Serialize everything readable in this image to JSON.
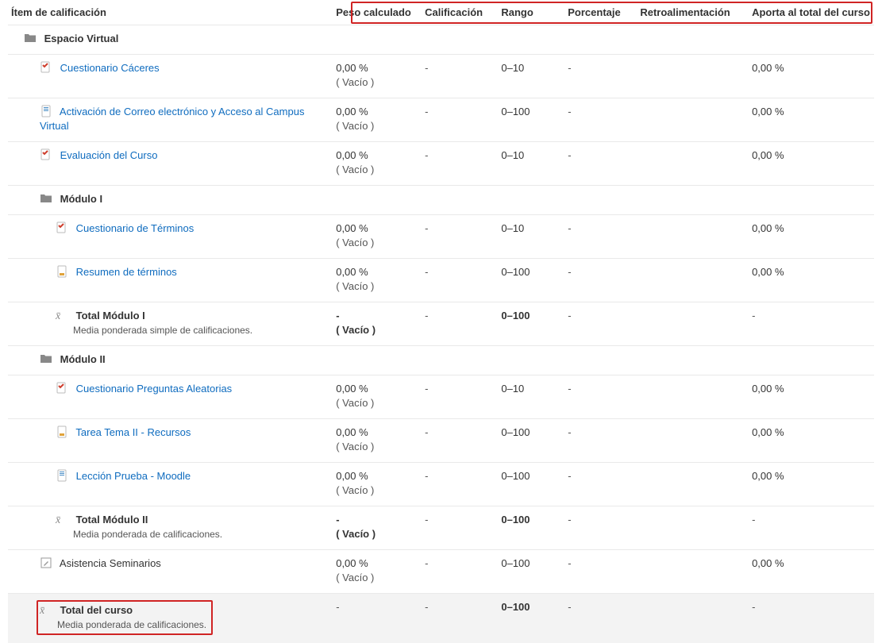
{
  "headers": {
    "item": "Ítem de calificación",
    "peso": "Peso calculado",
    "cal": "Calificación",
    "rango": "Rango",
    "pct": "Porcentaje",
    "retro": "Retroalimentación",
    "aporta": "Aporta al total del curso"
  },
  "values": {
    "empty": "( Vacío )",
    "emptyBold": "( Vacío )",
    "dash": "-"
  },
  "top": {
    "title": "Espacio Virtual",
    "items": [
      {
        "name": "Cuestionario Cáceres",
        "icon": "quiz",
        "peso": "0,00 %",
        "rango": "0–10",
        "aporta": "0,00 %"
      },
      {
        "name": "Activación de Correo electrónico y Acceso al Campus Virtual",
        "icon": "mail",
        "peso": "0,00 %",
        "rango": "0–100",
        "aporta": "0,00 %"
      },
      {
        "name": "Evaluación del Curso",
        "icon": "quiz",
        "peso": "0,00 %",
        "rango": "0–10",
        "aporta": "0,00 %"
      }
    ]
  },
  "mod1": {
    "title": "Módulo I",
    "items": [
      {
        "name": "Cuestionario de Términos",
        "icon": "quiz",
        "peso": "0,00 %",
        "rango": "0–10",
        "aporta": "0,00 %"
      },
      {
        "name": "Resumen de términos",
        "icon": "doc",
        "peso": "0,00 %",
        "rango": "0–100",
        "aporta": "0,00 %"
      }
    ],
    "total": {
      "title": "Total Módulo I",
      "sub": "Media ponderada simple de calificaciones.",
      "rango": "0–100"
    }
  },
  "mod2": {
    "title": "Módulo II",
    "items": [
      {
        "name": "Cuestionario Preguntas Aleatorias",
        "icon": "quiz",
        "peso": "0,00 %",
        "rango": "0–10",
        "aporta": "0,00 %"
      },
      {
        "name": "Tarea Tema II - Recursos",
        "icon": "doc",
        "peso": "0,00 %",
        "rango": "0–100",
        "aporta": "0,00 %"
      },
      {
        "name": "Lección Prueba - Moodle",
        "icon": "mail",
        "peso": "0,00 %",
        "rango": "0–100",
        "aporta": "0,00 %"
      }
    ],
    "total": {
      "title": "Total Módulo II",
      "sub": "Media ponderada de calificaciones.",
      "rango": "0–100"
    }
  },
  "attendance": {
    "name": "Asistencia Seminarios",
    "peso": "0,00 %",
    "rango": "0–100",
    "aporta": "0,00 %"
  },
  "courseTotal": {
    "title": "Total del curso",
    "sub": "Media ponderada de calificaciones.",
    "rango": "0–100"
  }
}
